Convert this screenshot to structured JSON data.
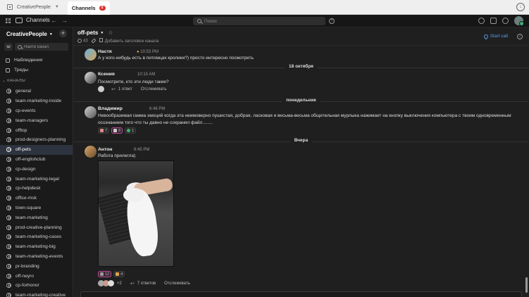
{
  "tabbar": {
    "workspace": "CreativePeople",
    "tab_label": "Channels",
    "tab_badge": "2"
  },
  "appbar": {
    "section": "Channels",
    "search_placeholder": "Поиск"
  },
  "sidebar": {
    "team": "CreativePeople",
    "find_placeholder": "Найти канал",
    "nav": [
      {
        "label": "Наблюдения"
      },
      {
        "label": "Треды"
      }
    ],
    "section_label": "КАНАЛЫ",
    "channels": [
      {
        "label": "general"
      },
      {
        "label": "team-marketing-inside"
      },
      {
        "label": "cp-events"
      },
      {
        "label": "team-managers"
      },
      {
        "label": "offtop"
      },
      {
        "label": "prod-designers-planning"
      },
      {
        "label": "off-pets"
      },
      {
        "label": "off-englishclub"
      },
      {
        "label": "cp-design"
      },
      {
        "label": "team-marketing-legal"
      },
      {
        "label": "cp-helpdesk"
      },
      {
        "label": "office-msk"
      },
      {
        "label": "town-square"
      },
      {
        "label": "team-marketing"
      },
      {
        "label": "prod-creative-planning"
      },
      {
        "label": "team-marketing-cases"
      },
      {
        "label": "team-marketing-big"
      },
      {
        "label": "team-marketing-events"
      },
      {
        "label": "pr-branding"
      },
      {
        "label": "off-neyro"
      },
      {
        "label": "cp-forhonor"
      },
      {
        "label": "team-marketing-creative"
      }
    ]
  },
  "channel": {
    "name": "off-pets",
    "members": "43",
    "add_header": "Добавить заголовок канала",
    "start_call": "Start call"
  },
  "messages": [
    {
      "user": "Настя",
      "time": "10:53 PM",
      "text": "А у кого-нибудь есть в питомцах кролики?) просто интересно посмотреть"
    },
    {
      "date": "18 октября"
    },
    {
      "user": "Ксения",
      "time": "10:15 AM",
      "text": "Посмотрите, кто эти люди такие?",
      "replies": "1 ответ",
      "follow": "Отслеживать"
    },
    {
      "date": "понедельник"
    },
    {
      "user": "Владимир",
      "time": "6:46 PM",
      "text": "Невообразимая гамма эмоций когда эта неимоверно пушистая, добрая, ласковая и весьма-весьма общительная мурлыка нажимает на кнопку выключения компьютера с твоим одновременным осознанием того что ты давно не сохранял файл........",
      "reactions": [
        "7",
        "8",
        "1"
      ]
    },
    {
      "date": "Вчера"
    },
    {
      "user": "Антон",
      "time": "6:45 PM",
      "text": "Работа прилегла)",
      "reactions": [
        "12",
        "4"
      ],
      "more_avatars": "+2",
      "replies": "7 ответов",
      "follow": "Отслеживать"
    }
  ],
  "colors": {
    "accent": "#5d9cec",
    "active_channel_bg": "#2e3340",
    "badge": "#d9322f",
    "mine_reaction": "#b94d96"
  }
}
